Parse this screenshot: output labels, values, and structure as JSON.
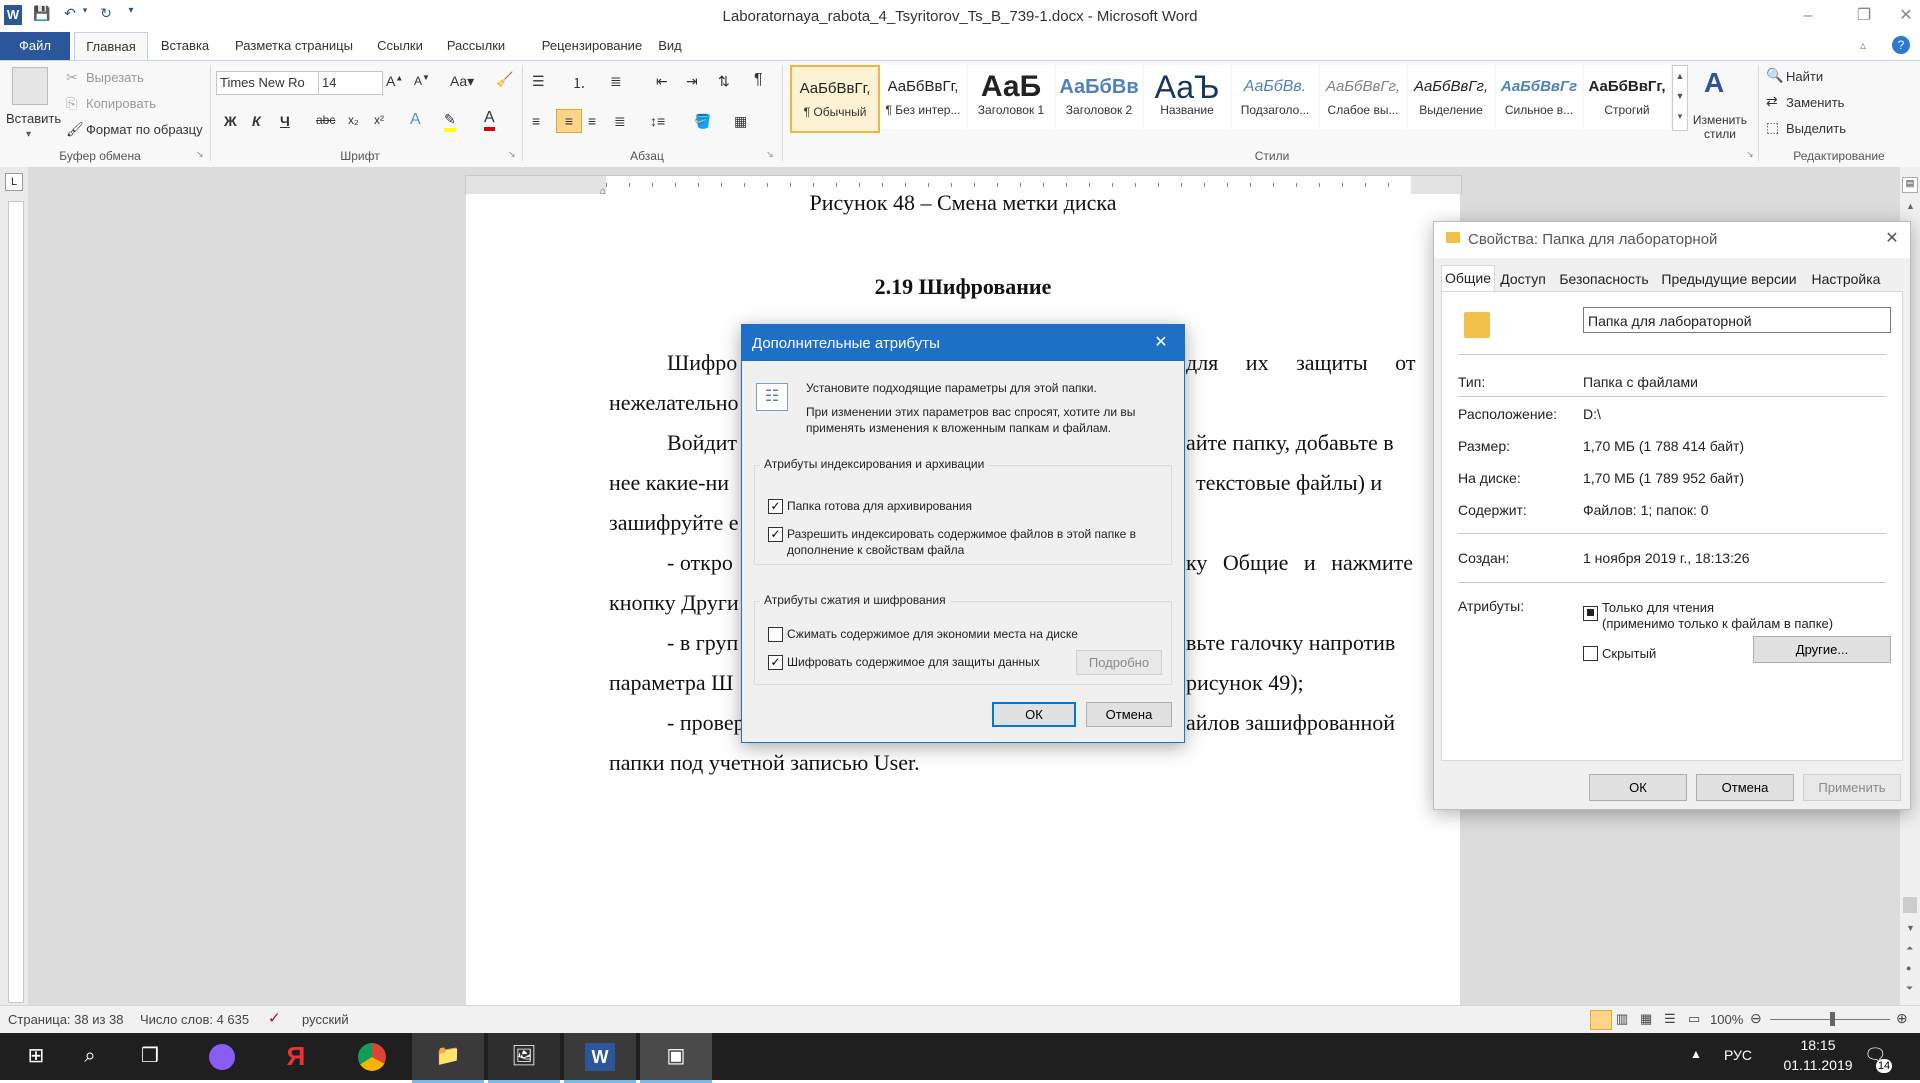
{
  "window": {
    "title": "Laboratornaya_rabota_4_Tsyritorov_Ts_B_739-1.docx - Microsoft Word"
  },
  "tabs": [
    "Файл",
    "Главная",
    "Вставка",
    "Разметка страницы",
    "Ссылки",
    "Рассылки",
    "Рецензирование",
    "Вид"
  ],
  "clipboard": {
    "paste": "Вставить",
    "cut": "Вырезать",
    "copy": "Копировать",
    "format": "Формат по образцу",
    "label": "Буфер обмена"
  },
  "font": {
    "name": "Times New Ro",
    "size": "14",
    "label": "Шрифт"
  },
  "paragraph": {
    "label": "Абзац"
  },
  "styles": {
    "label": "Стили",
    "change": "Изменить стили",
    "items": [
      {
        "sample": "АаБбВвГг,",
        "name": "¶ Обычный"
      },
      {
        "sample": "АаБбВвГг,",
        "name": "¶ Без интер..."
      },
      {
        "sample": "АаБ",
        "name": "Заголовок 1"
      },
      {
        "sample": "АаБбВв",
        "name": "Заголовок 2"
      },
      {
        "sample": "АаЪ",
        "name": "Название"
      },
      {
        "sample": "АаБбВв.",
        "name": "Подзаголо..."
      },
      {
        "sample": "АаБбВвГг,",
        "name": "Слабое вы..."
      },
      {
        "sample": "АаБбВвГг,",
        "name": "Выделение"
      },
      {
        "sample": "АаБбВвГг",
        "name": "Сильное в..."
      },
      {
        "sample": "АаБбВвГг,",
        "name": "Строгий"
      }
    ]
  },
  "editing": {
    "find": "Найти",
    "replace": "Заменить",
    "select": "Выделить",
    "label": "Редактирование"
  },
  "doc": {
    "caption": "Рисунок 48 – Смена метки диска",
    "heading": "2.19 Шифрование",
    "l1a": "Шифро",
    "l1b": "для их защиты от",
    "l2": "нежелательно",
    "l3a": "Войдит",
    "l3b": "айте папку, добавьте в",
    "l4a": "нее какие-ни",
    "l4b": "текстовые файлы) и",
    "l5": "зашифруйте е",
    "l6a": "- откро",
    "l6b": "ку Общие и нажмите",
    "l7": "кнопку Други",
    "l8a": "- в груп",
    "l8b": "вьте галочку напротив",
    "l9a": "параметра Ш",
    "l9b": "рисунок 49);",
    "l10a": "- провер",
    "l10b": "айлов зашифрованной",
    "l11": "папки под учетной записью User."
  },
  "dialog": {
    "title": "Дополнительные атрибуты",
    "intro": "Установите подходящие параметры для этой папки.",
    "note1": "При изменении этих параметров вас спросят, хотите ли вы",
    "note2": "применять изменения к вложенным папкам и файлам.",
    "group1": "Атрибуты индексирования и архивации",
    "archive": "Папка готова для архивирования",
    "index1": "Разрешить индексировать содержимое файлов в этой папке в",
    "index2": "дополнение к свойствам файла",
    "group2": "Атрибуты сжатия и шифрования",
    "compress": "Сжимать содержимое для экономии места на диске",
    "encrypt": "Шифровать содержимое для защиты данных",
    "details": "Подробно",
    "ok": "ОК",
    "cancel": "Отмена"
  },
  "props": {
    "title": "Свойства: Папка для лабораторной",
    "tabs": [
      "Общие",
      "Доступ",
      "Безопасность",
      "Предыдущие версии",
      "Настройка"
    ],
    "name": "Папка для лабораторной",
    "type_l": "Тип:",
    "type_v": "Папка с файлами",
    "loc_l": "Расположение:",
    "loc_v": "D:\\",
    "size_l": "Размер:",
    "size_v": "1,70 МБ (1 788 414 байт)",
    "disk_l": "На диске:",
    "disk_v": "1,70 МБ (1 789 952 байт)",
    "cont_l": "Содержит:",
    "cont_v": "Файлов: 1; папок: 0",
    "created_l": "Создан:",
    "created_v": "1 ноября 2019 г., 18:13:26",
    "attr_l": "Атрибуты:",
    "readonly1": "Только для чтения",
    "readonly2": "(применимо только к файлам в папке)",
    "hidden": "Скрытый",
    "other": "Другие...",
    "ok": "ОК",
    "cancel": "Отмена",
    "apply": "Применить"
  },
  "status": {
    "page": "Страница: 38 из 38",
    "words": "Число слов: 4 635",
    "lang": "русский",
    "zoom": "100%"
  },
  "taskbar": {
    "lang": "РУС",
    "time": "18:15",
    "date": "01.11.2019",
    "badge": "14"
  }
}
